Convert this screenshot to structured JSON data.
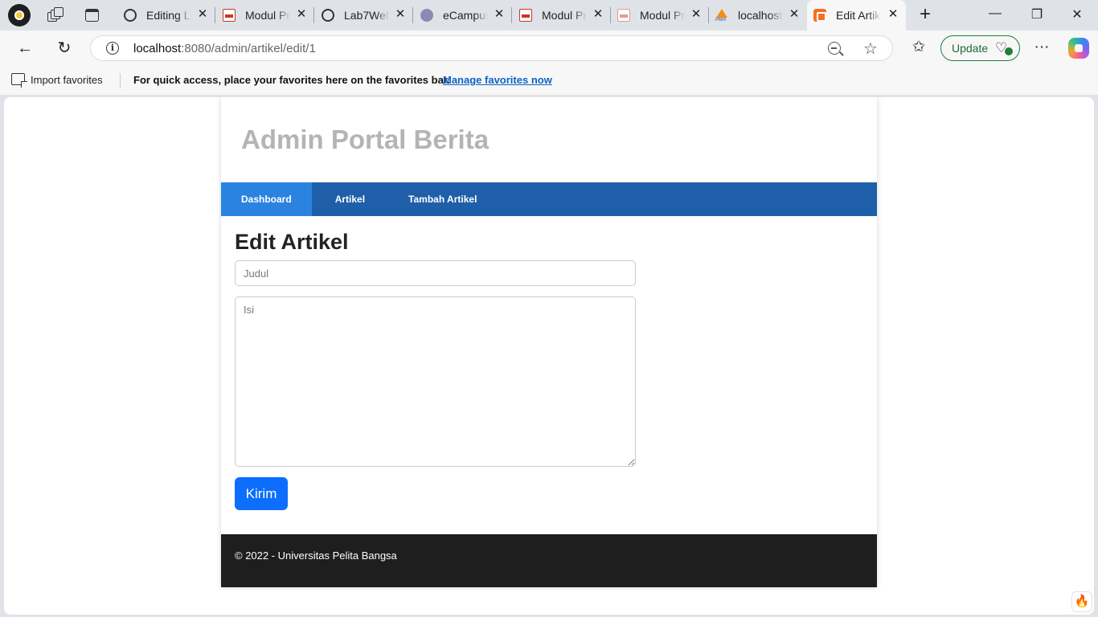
{
  "browser": {
    "tabs": [
      {
        "title": "Editing La",
        "favicon": "github-icon"
      },
      {
        "title": "Modul Pr",
        "favicon": "pdf-icon"
      },
      {
        "title": "Lab7Web",
        "favicon": "github-icon"
      },
      {
        "title": "eCampus",
        "favicon": "ecampus-icon"
      },
      {
        "title": "Modul Pr",
        "favicon": "pdf-icon"
      },
      {
        "title": "Modul Pr",
        "favicon": "pdf-icon"
      },
      {
        "title": "localhost",
        "favicon": "phpmyadmin-icon"
      },
      {
        "title": "Edit Artik",
        "favicon": "xampp-icon",
        "active": true
      }
    ],
    "address": {
      "host": "localhost",
      "path": ":8080/admin/artikel/edit/1"
    },
    "update_label": "Update",
    "favorites_bar": {
      "import_label": "Import favorites",
      "message": "For quick access, place your favorites here on the favorites bar.",
      "manage_link": "Manage favorites now"
    },
    "accent_color": "#1e7e3e"
  },
  "site": {
    "title": "Admin Portal Berita",
    "nav": [
      {
        "label": "Dashboard",
        "active": true
      },
      {
        "label": "Artikel"
      },
      {
        "label": "Tambah Artikel"
      }
    ],
    "nav_color": "#1f5fa9",
    "nav_active_color": "#2b83e0"
  },
  "form": {
    "heading": "Edit Artikel",
    "title_placeholder": "Judul",
    "title_value": "",
    "body_placeholder": "Isi",
    "body_value": "",
    "submit_label": "Kirim",
    "submit_color": "#0d6efd"
  },
  "footer": {
    "text": "© 2022 - Universitas Pelita Bangsa"
  }
}
